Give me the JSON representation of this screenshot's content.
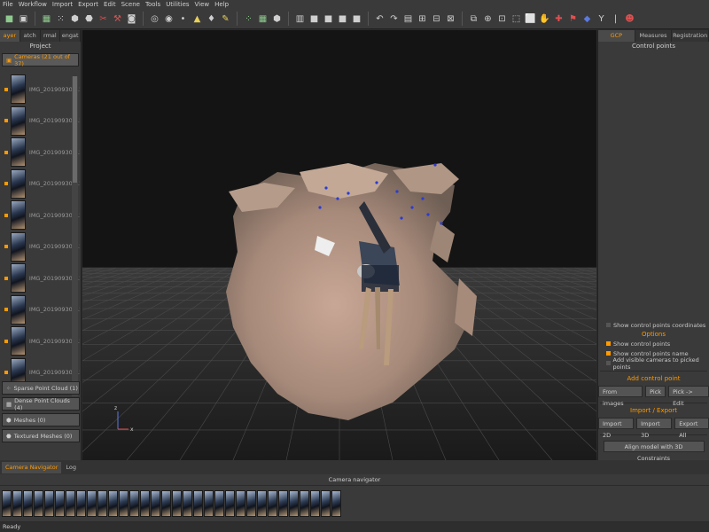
{
  "menu": [
    "File",
    "Workflow",
    "Import",
    "Export",
    "Edit",
    "Scene",
    "Tools",
    "Utilities",
    "View",
    "Help"
  ],
  "toolbar_icons": [
    "open-icon",
    "save-icon",
    "camera-grid-icon",
    "dots-icon",
    "mesh-icon",
    "texture-icon",
    "scissors-icon",
    "tools-icon",
    "capture-icon",
    "rotate-icon",
    "pivot-icon",
    "point-icon",
    "triangle-icon",
    "droplet-icon",
    "brush-icon",
    "points-icon",
    "grid-icon",
    "solid-icon",
    "wire-icon",
    "box-icon",
    "box2-icon",
    "box3-icon",
    "box4-icon",
    "undo-icon",
    "redo-icon",
    "select-icon",
    "lasso-icon",
    "region-icon",
    "crop-icon",
    "layer-icon",
    "target-icon",
    "filter-icon",
    "scale-icon",
    "frame-icon",
    "hand-icon",
    "pin-icon",
    "flag-icon",
    "palette-icon",
    "axis-icon",
    "ruler-icon",
    "robot-icon"
  ],
  "left_panel": {
    "tabs": [
      "ayer",
      "atch",
      "rmal",
      "engat"
    ],
    "title": "Project",
    "cameras_group": "Cameras (21 out of 37)",
    "cameras": [
      "IMG_20190930_12",
      "IMG_20190930_12",
      "IMG_20190930_12",
      "IMG_20190930_12",
      "IMG_20190930_12",
      "IMG_20190930_12",
      "IMG_20190930_12",
      "IMG_20190930_12",
      "IMG_20190930_12",
      "IMG_20190930_12"
    ],
    "groups": [
      "Sparse Point Cloud (1)",
      "Dense Point Clouds (4)",
      "Meshes (0)",
      "Textured Meshes (0)"
    ]
  },
  "viewport": {
    "axis_z": "z",
    "axis_x": "x"
  },
  "right_panel": {
    "tabs": [
      "GCP",
      "Measures",
      "Registration"
    ],
    "title": "Control points",
    "show_coords": "Show control points coordinates",
    "options_label": "Options",
    "options": [
      {
        "label": "Show control points",
        "checked": true
      },
      {
        "label": "Show control points name",
        "checked": true
      },
      {
        "label": "Add visible cameras to picked points",
        "checked": false
      }
    ],
    "add_label": "Add control point",
    "add_buttons": [
      "From images",
      "Pick",
      "Pick -> Edit"
    ],
    "import_label": "Import / Export",
    "import_buttons": [
      "Import 2D",
      "Import 3D",
      "Export All"
    ],
    "align_button": "Align model with 3D Constraints"
  },
  "bottom": {
    "tabs": [
      "Camera Navigator",
      "Log"
    ],
    "nav_title": "Camera navigator",
    "status": "Ready"
  },
  "colors": {
    "accent": "#ff9a00",
    "panel": "#3a3a3a",
    "viewport": "#141414"
  }
}
